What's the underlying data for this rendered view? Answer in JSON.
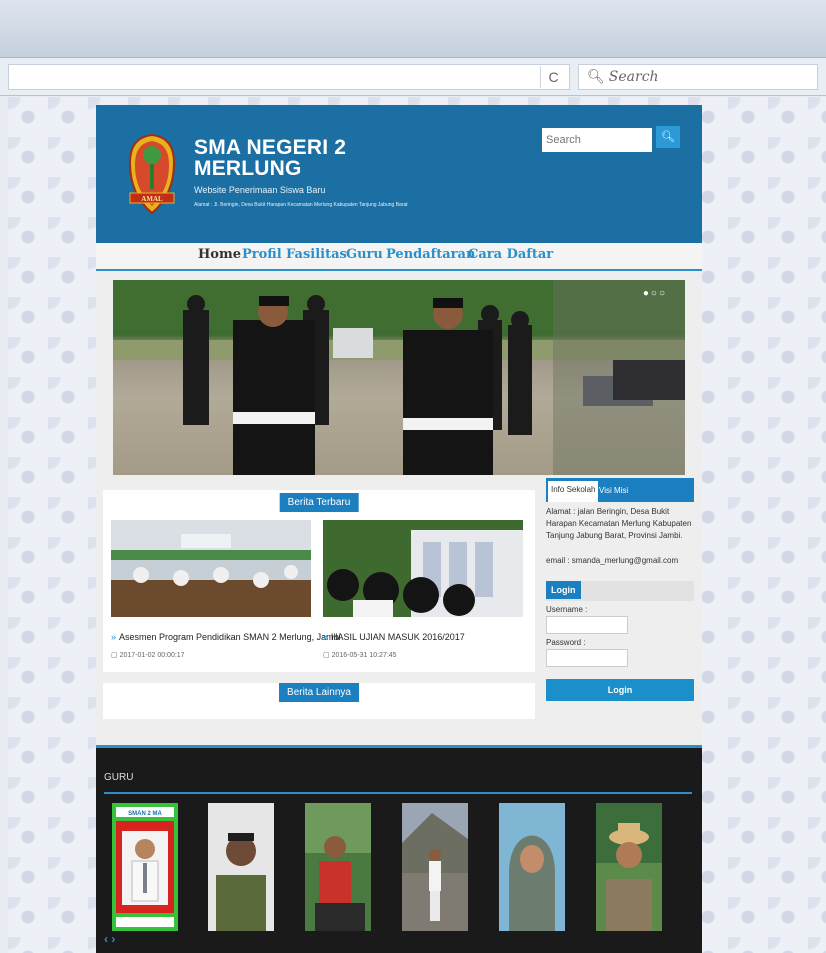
{
  "browser": {
    "search_placeholder": "Search",
    "reload_glyph": "C"
  },
  "header": {
    "title": "SMA NEGERI 2 MERLUNG",
    "subtitle": "Website Penerimaan Siswa Baru",
    "address": "Alamat : Jl. Beringin, Desa Bukit Harapan Kecamatan Merlung Kabupaten Tanjung Jabung Barat",
    "logo_text": "AMAL",
    "search_placeholder": "Search",
    "search_icon": "search-icon"
  },
  "nav": [
    "Home",
    "Profil",
    "Fasilitas",
    "Guru",
    "Pendaftaran",
    "Cara Daftar"
  ],
  "news": {
    "section_title": "Berita Terbaru",
    "items": [
      {
        "title": "Asesmen Program Pendidikan SMAN 2 Merlung, Jambi",
        "date": "2017-01-02 00:00:17"
      },
      {
        "title": "HASIL UJIAN MASUK 2016/2017",
        "date": "2016-05-31 10:27:45"
      }
    ],
    "other_title": "Berita Lainnya"
  },
  "sidebar": {
    "tabs": [
      "Info Sekolah",
      "Visi Misi"
    ],
    "info": "Alamat : jalan Beringin, Desa Bukit Harapan Kecamatan Merlung Kabupaten Tanjung Jabung Barat, Provinsi Jambi.",
    "email": "email : smanda_merlung@gmail.com",
    "login_title": "Login",
    "username_label": "Username :",
    "password_label": "Password :",
    "login_button": "Login"
  },
  "guru": {
    "title": "GURU",
    "badge_text": "SMAN 2 MA",
    "nav": "‹ ›"
  },
  "colors": {
    "header_blue": "#1b6fa3",
    "accent_blue": "#2b8fc9",
    "footer_dark": "#1a1a1a"
  }
}
